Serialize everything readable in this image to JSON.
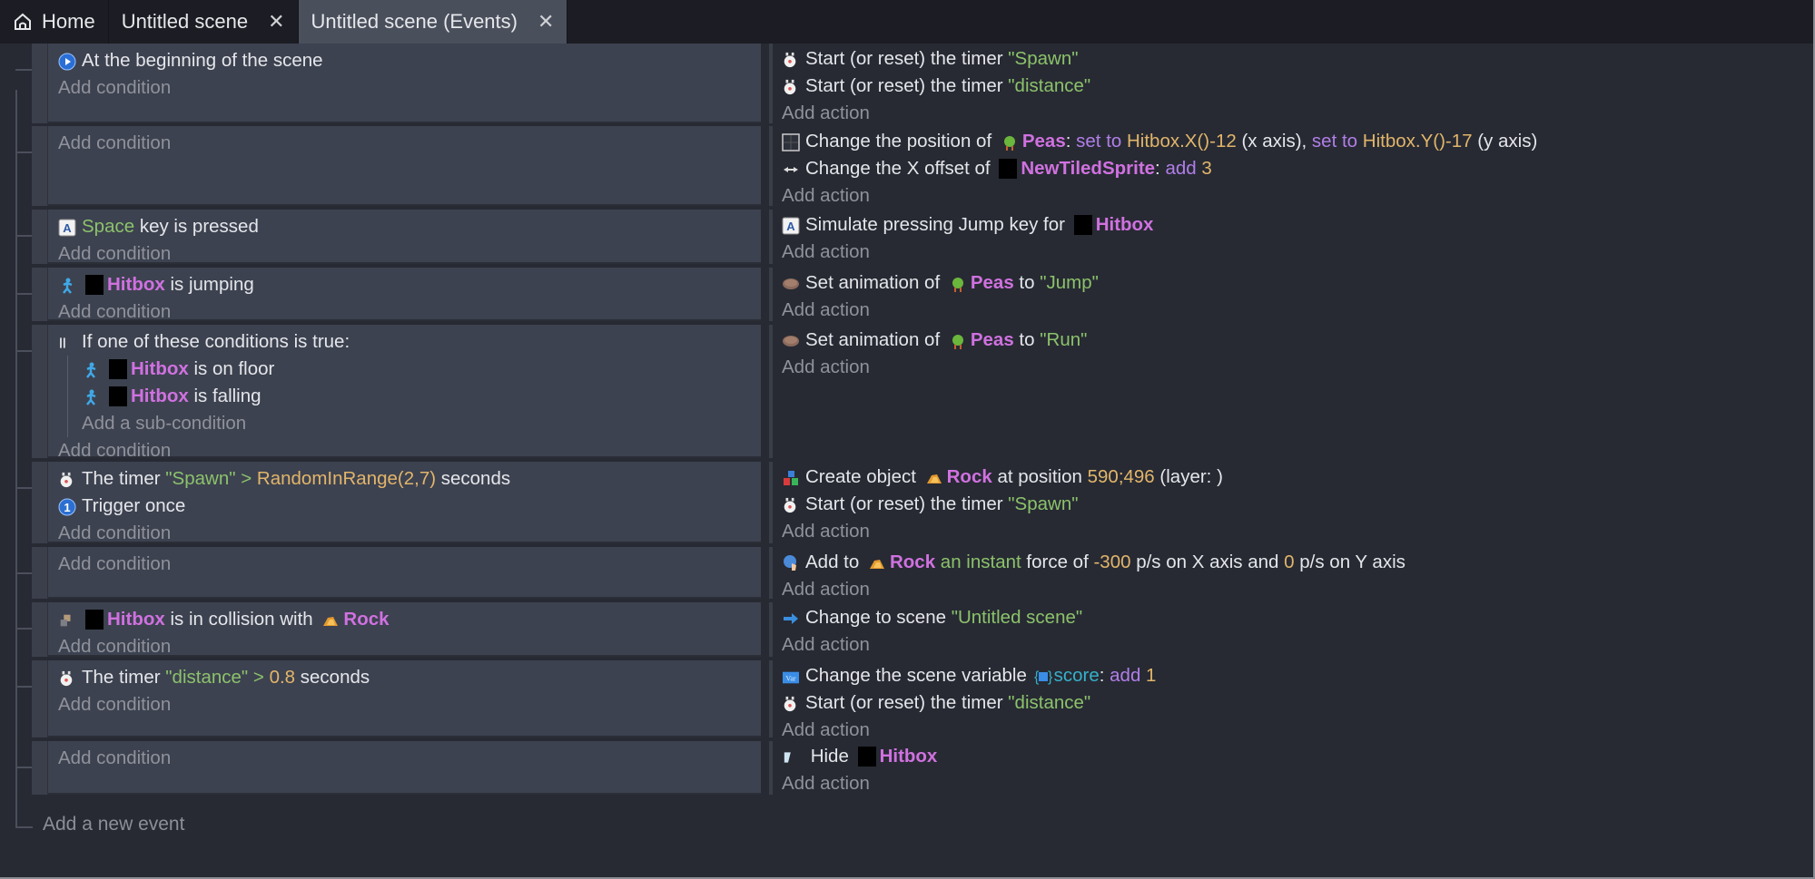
{
  "tabs": [
    {
      "label": "Home",
      "icon": "home-icon",
      "closable": false,
      "active": false
    },
    {
      "label": "Untitled scene",
      "closable": true,
      "active": false
    },
    {
      "label": "Untitled scene (Events)",
      "closable": true,
      "active": true
    }
  ],
  "close_glyph": "✕",
  "add_condition_label": "Add condition",
  "add_action_label": "Add action",
  "add_subcondition_label": "Add a sub-condition",
  "add_new_event_label": "Add a new event",
  "events": [
    {
      "conditions": [
        {
          "icon": "scene-start-icon",
          "parts": [
            {
              "t": "At the beginning of the scene"
            }
          ]
        }
      ],
      "actions": [
        {
          "icon": "timer-icon",
          "parts": [
            {
              "t": "Start (or reset) the timer "
            },
            {
              "t": "\"Spawn\"",
              "c": "str"
            }
          ]
        },
        {
          "icon": "timer-icon",
          "parts": [
            {
              "t": "Start (or reset) the timer "
            },
            {
              "t": "\"distance\"",
              "c": "str"
            }
          ]
        }
      ]
    },
    {
      "conditions": [],
      "actions": [
        {
          "icon": "position-icon",
          "parts": [
            {
              "t": "Change the position of "
            },
            {
              "obj": "peas"
            },
            {
              "t": "Peas",
              "c": "obj"
            },
            {
              "t": ": "
            },
            {
              "t": "set to ",
              "c": "op"
            },
            {
              "t": "Hitbox.X()-12",
              "c": "num"
            },
            {
              "t": " (x axis), "
            },
            {
              "t": "set to ",
              "c": "op"
            },
            {
              "t": "Hitbox.Y()-17",
              "c": "num"
            },
            {
              "t": " (y axis)"
            }
          ]
        },
        {
          "icon": "offset-icon",
          "parts": [
            {
              "t": "Change the X offset of "
            },
            {
              "obj": "black"
            },
            {
              "t": "NewTiledSprite",
              "c": "obj"
            },
            {
              "t": ": "
            },
            {
              "t": "add ",
              "c": "op"
            },
            {
              "t": "3",
              "c": "num"
            }
          ]
        }
      ]
    },
    {
      "conditions": [
        {
          "icon": "keyboard-icon",
          "parts": [
            {
              "t": "Space",
              "c": "grn"
            },
            {
              "t": " key is pressed"
            }
          ]
        }
      ],
      "actions": [
        {
          "icon": "keyboard-icon",
          "parts": [
            {
              "t": "Simulate pressing Jump key for "
            },
            {
              "obj": "black"
            },
            {
              "t": "Hitbox",
              "c": "obj"
            }
          ]
        }
      ]
    },
    {
      "conditions": [
        {
          "icon": "platformer-icon",
          "parts": [
            {
              "obj": "black"
            },
            {
              "t": "Hitbox",
              "c": "obj"
            },
            {
              "t": " is jumping"
            }
          ]
        }
      ],
      "actions": [
        {
          "icon": "animation-icon",
          "parts": [
            {
              "t": "Set animation of "
            },
            {
              "obj": "peas"
            },
            {
              "t": "Peas",
              "c": "obj"
            },
            {
              "t": " to "
            },
            {
              "t": "\"Jump\"",
              "c": "str"
            }
          ]
        }
      ]
    },
    {
      "conditions": [
        {
          "icon": "or-icon",
          "parts": [
            {
              "t": "If one of these conditions is true:"
            }
          ],
          "sub": [
            {
              "icon": "platformer-icon",
              "parts": [
                {
                  "obj": "black"
                },
                {
                  "t": "Hitbox",
                  "c": "obj"
                },
                {
                  "t": " is on floor"
                }
              ]
            },
            {
              "icon": "platformer-icon",
              "parts": [
                {
                  "obj": "black"
                },
                {
                  "t": "Hitbox",
                  "c": "obj"
                },
                {
                  "t": " is falling"
                }
              ]
            }
          ]
        }
      ],
      "actions": [
        {
          "icon": "animation-icon",
          "parts": [
            {
              "t": "Set animation of "
            },
            {
              "obj": "peas"
            },
            {
              "t": "Peas",
              "c": "obj"
            },
            {
              "t": " to "
            },
            {
              "t": "\"Run\"",
              "c": "str"
            }
          ]
        }
      ]
    },
    {
      "conditions": [
        {
          "icon": "timer-icon",
          "parts": [
            {
              "t": "The timer "
            },
            {
              "t": "\"Spawn\"",
              "c": "str"
            },
            {
              "t": " > ",
              "c": "grn"
            },
            {
              "t": "RandomInRange(2,7)",
              "c": "num"
            },
            {
              "t": " seconds"
            }
          ]
        },
        {
          "icon": "trigger-once-icon",
          "parts": [
            {
              "t": "Trigger once"
            }
          ]
        }
      ],
      "actions": [
        {
          "icon": "create-object-icon",
          "parts": [
            {
              "t": "Create object "
            },
            {
              "obj": "rock"
            },
            {
              "t": "Rock",
              "c": "obj"
            },
            {
              "t": " at position "
            },
            {
              "t": "590;496",
              "c": "num"
            },
            {
              "t": " (layer: )"
            }
          ]
        },
        {
          "icon": "timer-icon",
          "parts": [
            {
              "t": "Start (or reset) the timer "
            },
            {
              "t": "\"Spawn\"",
              "c": "str"
            }
          ]
        }
      ]
    },
    {
      "conditions": [],
      "actions": [
        {
          "icon": "force-icon",
          "parts": [
            {
              "t": "Add to "
            },
            {
              "obj": "rock"
            },
            {
              "t": "Rock",
              "c": "obj"
            },
            {
              "t": " an instant",
              "c": "grn"
            },
            {
              "t": " force of "
            },
            {
              "t": "-300",
              "c": "num"
            },
            {
              "t": " p/s on X axis and "
            },
            {
              "t": "0",
              "c": "num"
            },
            {
              "t": " p/s on Y axis"
            }
          ]
        }
      ]
    },
    {
      "conditions": [
        {
          "icon": "collision-icon",
          "parts": [
            {
              "obj": "black"
            },
            {
              "t": "Hitbox",
              "c": "obj"
            },
            {
              "t": " is in collision with "
            },
            {
              "obj": "rock"
            },
            {
              "t": "Rock",
              "c": "obj"
            }
          ]
        }
      ],
      "actions": [
        {
          "icon": "change-scene-icon",
          "parts": [
            {
              "t": "Change to scene "
            },
            {
              "t": "\"Untitled scene\"",
              "c": "str"
            }
          ]
        }
      ]
    },
    {
      "conditions": [
        {
          "icon": "timer-icon",
          "parts": [
            {
              "t": "The timer "
            },
            {
              "t": "\"distance\"",
              "c": "str"
            },
            {
              "t": " > ",
              "c": "grn"
            },
            {
              "t": "0.8",
              "c": "num"
            },
            {
              "t": " seconds"
            }
          ]
        }
      ],
      "actions": [
        {
          "icon": "variable-icon",
          "parts": [
            {
              "t": "Change the scene variable "
            },
            {
              "varicon": true
            },
            {
              "t": "score",
              "c": "var"
            },
            {
              "t": ": "
            },
            {
              "t": "add ",
              "c": "op"
            },
            {
              "t": "1",
              "c": "num"
            }
          ]
        },
        {
          "icon": "timer-icon",
          "parts": [
            {
              "t": "Start (or reset) the timer "
            },
            {
              "t": "\"distance\"",
              "c": "str"
            }
          ]
        }
      ]
    },
    {
      "conditions": [],
      "actions": [
        {
          "icon": "hide-icon",
          "parts": [
            {
              "t": " Hide "
            },
            {
              "obj": "black"
            },
            {
              "t": "Hitbox",
              "c": "obj"
            }
          ]
        }
      ]
    }
  ]
}
